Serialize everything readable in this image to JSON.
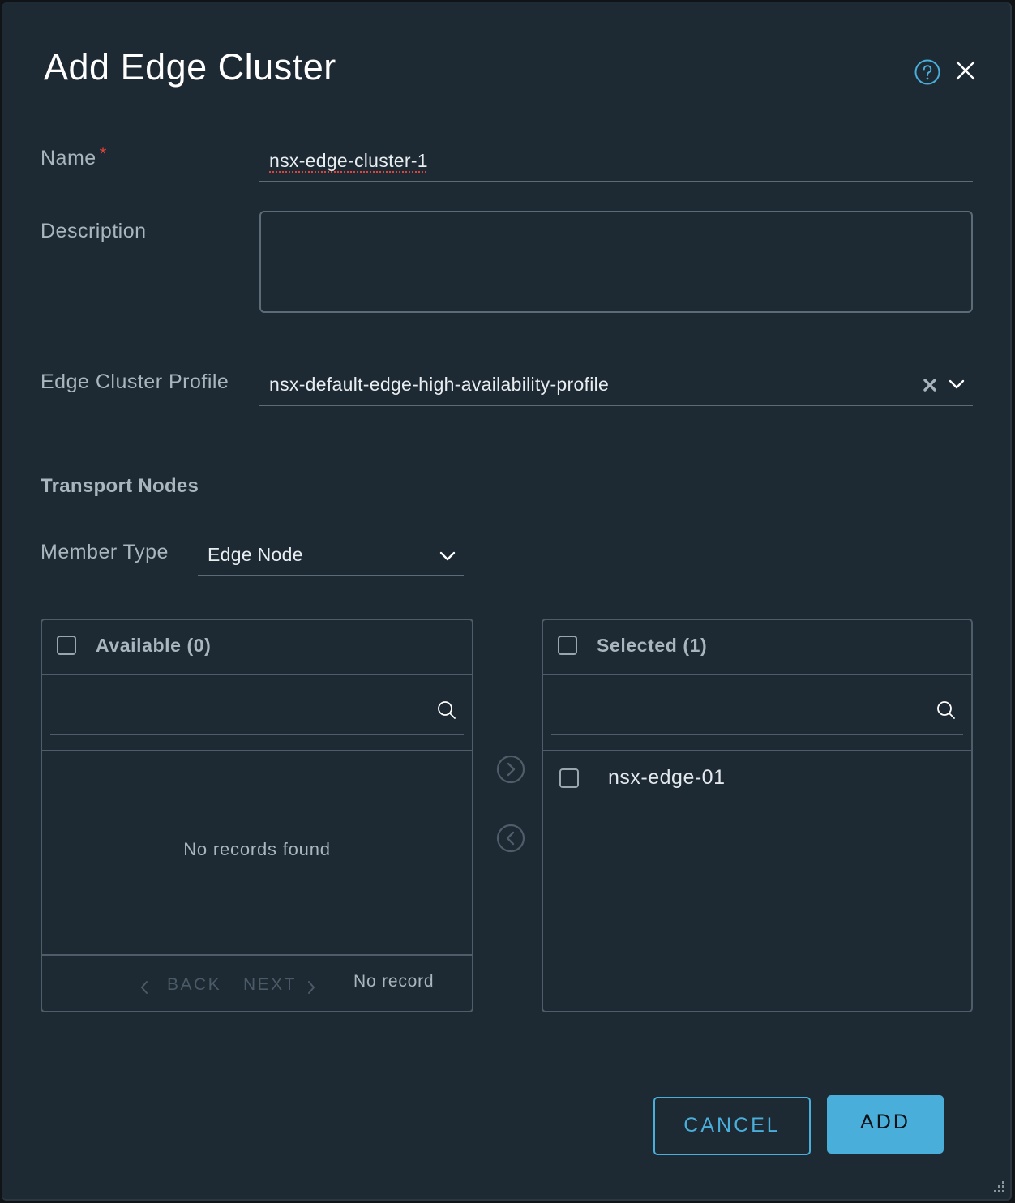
{
  "dialog": {
    "title": "Add Edge Cluster",
    "help_icon": "help-circle-icon",
    "close_icon": "close-icon"
  },
  "form": {
    "name": {
      "label": "Name",
      "required_marker": "*",
      "value": "nsx-edge-cluster-1"
    },
    "description": {
      "label": "Description",
      "value": "",
      "placeholder": ""
    },
    "edge_cluster_profile": {
      "label": "Edge Cluster Profile",
      "value": "nsx-default-edge-high-availability-profile",
      "clear_icon": "clear-x-icon",
      "dropdown_icon": "chevron-down-icon"
    }
  },
  "transport_nodes": {
    "section_title": "Transport Nodes",
    "member_type": {
      "label": "Member Type",
      "value": "Edge Node"
    },
    "available": {
      "title": "Available (0)",
      "search_placeholder": "",
      "empty_text": "No records found",
      "pager": {
        "back_label": "BACK",
        "next_label": "NEXT",
        "status": "No record"
      }
    },
    "move_right_icon": "chevron-right-circle-icon",
    "move_left_icon": "chevron-left-circle-icon",
    "selected": {
      "title": "Selected (1)",
      "search_placeholder": "",
      "items": [
        {
          "label": "nsx-edge-01",
          "checked": false
        }
      ]
    }
  },
  "footer": {
    "cancel_label": "CANCEL",
    "add_label": "ADD"
  },
  "colors": {
    "background": "#1d2933",
    "accent": "#49aed9",
    "required": "#e0433b",
    "label": "#aab6be",
    "border": "#4e5d69"
  }
}
